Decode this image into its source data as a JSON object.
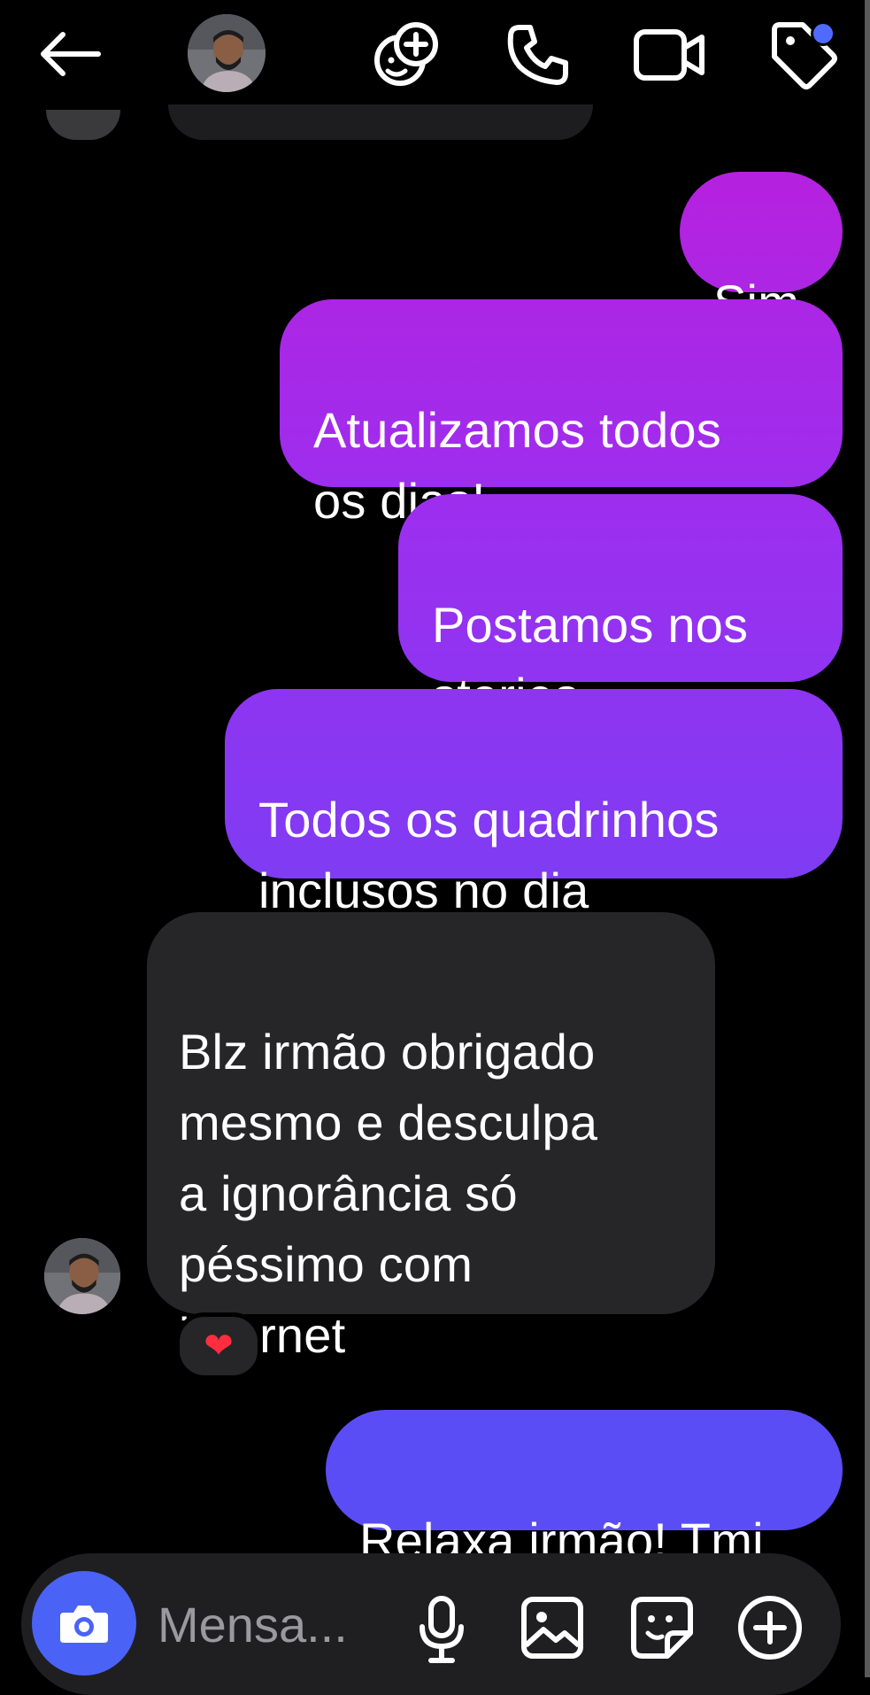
{
  "header": {
    "back_icon": "arrow-left-icon",
    "contact_avatar_icon": "avatar-photo",
    "actions": [
      {
        "name": "effects-icon"
      },
      {
        "name": "phone-icon"
      },
      {
        "name": "video-camera-icon"
      },
      {
        "name": "tag-icon"
      }
    ],
    "notification_color": "#4f6bff"
  },
  "messages": [
    {
      "direction": "outgoing",
      "text": "Sim"
    },
    {
      "direction": "outgoing",
      "text": "Atualizamos todos\nos dias!"
    },
    {
      "direction": "outgoing",
      "text": "Postamos nos\nstories"
    },
    {
      "direction": "outgoing",
      "text": "Todos os quadrinhos\ninclusos no dia"
    },
    {
      "direction": "incoming",
      "text": "Blz irmão obrigado\nmesmo e desculpa\na ignorância só\npéssimo com\ninternet",
      "reaction": "❤"
    },
    {
      "direction": "outgoing",
      "text": "Relaxa irmão! Tmj"
    }
  ],
  "composer": {
    "placeholder": "Mensa...",
    "icons": [
      "camera-icon",
      "microphone-icon",
      "image-icon",
      "sticker-icon",
      "plus-circle-icon"
    ],
    "camera_color": "#4a63f6"
  },
  "colors": {
    "outgoing_top": "#c21bd6",
    "outgoing_bottom": "#5b4df5",
    "incoming": "#262628",
    "background": "#000000"
  }
}
